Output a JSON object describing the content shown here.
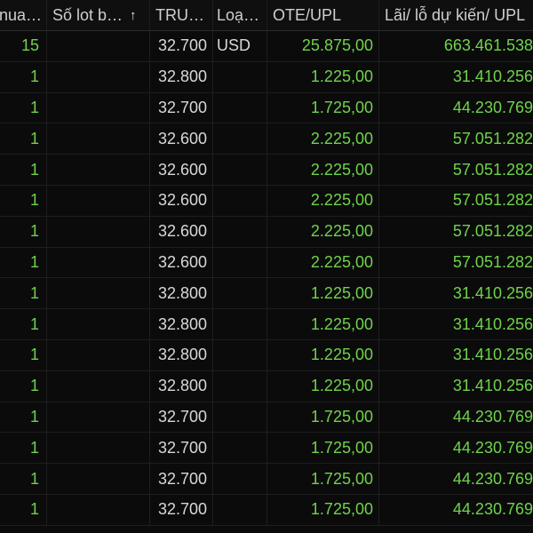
{
  "table": {
    "headers": {
      "col0": "nua…",
      "col1": "Số lot b…",
      "col2": "TRU…",
      "col3": "Loạ…",
      "col4": "OTE/UPL",
      "col5": "Lãi/ lỗ dự kiến/ UPL"
    },
    "sort_icon": "arrow-up-icon",
    "sort_glyph": "↑",
    "rows": [
      {
        "qty": "15",
        "lots": "",
        "price": "32.700",
        "type": "USD",
        "ote": "25.875,00",
        "upl": "663.461.538"
      },
      {
        "qty": "1",
        "lots": "",
        "price": "32.800",
        "type": "",
        "ote": "1.225,00",
        "upl": "31.410.256"
      },
      {
        "qty": "1",
        "lots": "",
        "price": "32.700",
        "type": "",
        "ote": "1.725,00",
        "upl": "44.230.769"
      },
      {
        "qty": "1",
        "lots": "",
        "price": "32.600",
        "type": "",
        "ote": "2.225,00",
        "upl": "57.051.282"
      },
      {
        "qty": "1",
        "lots": "",
        "price": "32.600",
        "type": "",
        "ote": "2.225,00",
        "upl": "57.051.282"
      },
      {
        "qty": "1",
        "lots": "",
        "price": "32.600",
        "type": "",
        "ote": "2.225,00",
        "upl": "57.051.282"
      },
      {
        "qty": "1",
        "lots": "",
        "price": "32.600",
        "type": "",
        "ote": "2.225,00",
        "upl": "57.051.282"
      },
      {
        "qty": "1",
        "lots": "",
        "price": "32.600",
        "type": "",
        "ote": "2.225,00",
        "upl": "57.051.282"
      },
      {
        "qty": "1",
        "lots": "",
        "price": "32.800",
        "type": "",
        "ote": "1.225,00",
        "upl": "31.410.256"
      },
      {
        "qty": "1",
        "lots": "",
        "price": "32.800",
        "type": "",
        "ote": "1.225,00",
        "upl": "31.410.256"
      },
      {
        "qty": "1",
        "lots": "",
        "price": "32.800",
        "type": "",
        "ote": "1.225,00",
        "upl": "31.410.256"
      },
      {
        "qty": "1",
        "lots": "",
        "price": "32.800",
        "type": "",
        "ote": "1.225,00",
        "upl": "31.410.256"
      },
      {
        "qty": "1",
        "lots": "",
        "price": "32.700",
        "type": "",
        "ote": "1.725,00",
        "upl": "44.230.769"
      },
      {
        "qty": "1",
        "lots": "",
        "price": "32.700",
        "type": "",
        "ote": "1.725,00",
        "upl": "44.230.769"
      },
      {
        "qty": "1",
        "lots": "",
        "price": "32.700",
        "type": "",
        "ote": "1.725,00",
        "upl": "44.230.769"
      },
      {
        "qty": "1",
        "lots": "",
        "price": "32.700",
        "type": "",
        "ote": "1.725,00",
        "upl": "44.230.769"
      }
    ]
  },
  "colors": {
    "background": "#0b0b0b",
    "positive": "#6fd34b",
    "text": "#d8d8d8",
    "gridline": "#1e1e1e"
  }
}
